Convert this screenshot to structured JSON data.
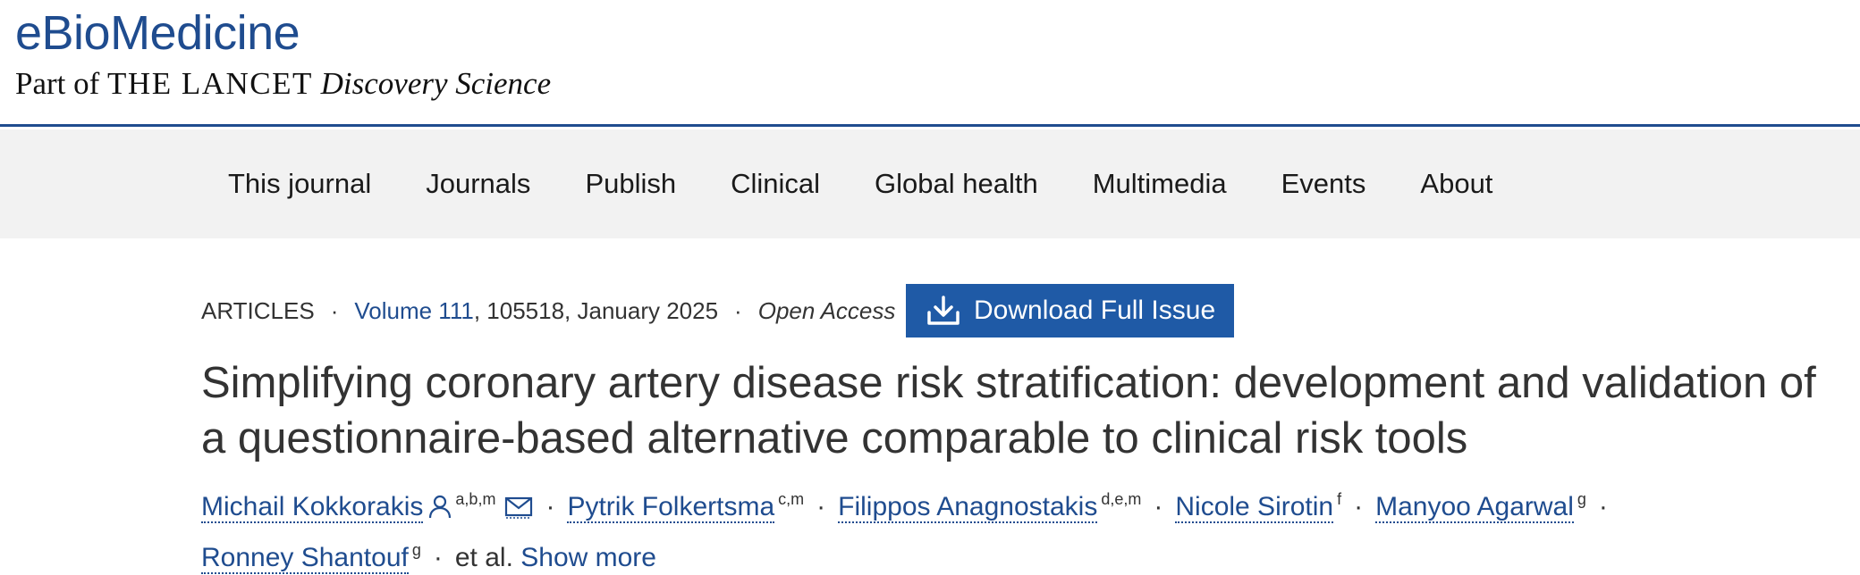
{
  "brand": {
    "title": "eBioMedicine",
    "sub_prefix": "Part of ",
    "sub_lancet": "THE LANCET",
    "sub_suffix": "Discovery Science"
  },
  "nav": {
    "items": [
      "This journal",
      "Journals",
      "Publish",
      "Clinical",
      "Global health",
      "Multimedia",
      "Events",
      "About"
    ]
  },
  "article": {
    "type": "ARTICLES",
    "volume_link": "Volume 111",
    "volume_rest": ", 105518, January 2025",
    "access": "Open Access",
    "download_label": "Download Full Issue",
    "title_line1": "Simplifying coronary artery disease risk stratification: development and validation of",
    "title_line2": "a questionnaire-based alternative comparable to clinical risk tools",
    "authors": [
      {
        "name": "Michail Kokkorakis",
        "sup": "a,b,m"
      },
      {
        "name": "Pytrik Folkertsma",
        "sup": "c,m"
      },
      {
        "name": "Filippos Anagnostakis",
        "sup": "d,e,m"
      },
      {
        "name": "Nicole Sirotin",
        "sup": "f"
      },
      {
        "name": "Manyoo Agarwal",
        "sup": "g"
      },
      {
        "name": "Ronney Shantouf",
        "sup": "g"
      }
    ],
    "et_al": "et al.",
    "show_more": "Show more"
  },
  "colors": {
    "brand_blue": "#1f4c8f",
    "button_blue": "#1f5aa6",
    "nav_bg": "#f2f2f2"
  }
}
